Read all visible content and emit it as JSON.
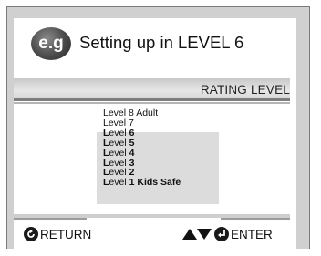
{
  "header": {
    "badge": "e.g",
    "title": "Setting up in LEVEL 6"
  },
  "menu": {
    "title": "RATING LEVEL",
    "levels": [
      {
        "prefix": "Level",
        "value": "8 Adult",
        "bold": false
      },
      {
        "prefix": "Level",
        "value": "7",
        "bold": false
      },
      {
        "prefix": "L",
        "rest": "evel",
        "value": "6",
        "bold": true
      },
      {
        "prefix": "L",
        "rest": "evel",
        "value": "5",
        "bold": true
      },
      {
        "prefix": "L",
        "rest": "evel",
        "value": "4",
        "bold": true
      },
      {
        "prefix": "L",
        "rest": "evel",
        "value": "3",
        "bold": true
      },
      {
        "prefix": "L",
        "rest": "evel",
        "value": "2",
        "bold": true
      },
      {
        "prefix": "L",
        "rest": "evel",
        "value": "1 Kids Safe",
        "bold": true
      }
    ]
  },
  "footer": {
    "return_label": "RETURN",
    "enter_label": "ENTER"
  },
  "colors": {
    "badge": "#4a4a4a",
    "frame": "#d0d0d0",
    "highlight": "#dcdcdc"
  },
  "icons": [
    "return-icon",
    "up-arrow-icon",
    "down-arrow-icon",
    "enter-icon"
  ]
}
